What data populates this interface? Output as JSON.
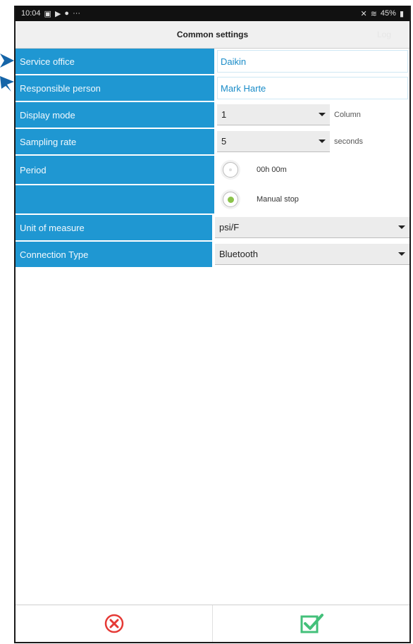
{
  "status": {
    "time": "10:04",
    "battery": "45%"
  },
  "header": {
    "title": "Common settings",
    "log_label": "Log"
  },
  "settings": {
    "service_office": {
      "label": "Service office",
      "value": "Daikin"
    },
    "responsible_person": {
      "label": "Responsible person",
      "value": "Mark Harte"
    },
    "display_mode": {
      "label": "Display mode",
      "value": "1",
      "suffix": "Column"
    },
    "sampling_rate": {
      "label": "Sampling rate",
      "value": "5",
      "suffix": "seconds"
    },
    "period": {
      "label": "Period",
      "option_duration": "00h 00m",
      "option_manual": "Manual stop",
      "selected": "manual"
    },
    "unit_of_measure": {
      "label": "Unit of measure",
      "value": "psi/F"
    },
    "connection_type": {
      "label": "Connection Type",
      "value": "Bluetooth"
    }
  },
  "colors": {
    "accent": "#1f97d2",
    "cancel": "#e53935",
    "confirm": "#43c07a",
    "radio_on": "#8bc34a"
  },
  "icons": {
    "cancel": "close-circle-icon",
    "confirm": "check-box-icon"
  }
}
